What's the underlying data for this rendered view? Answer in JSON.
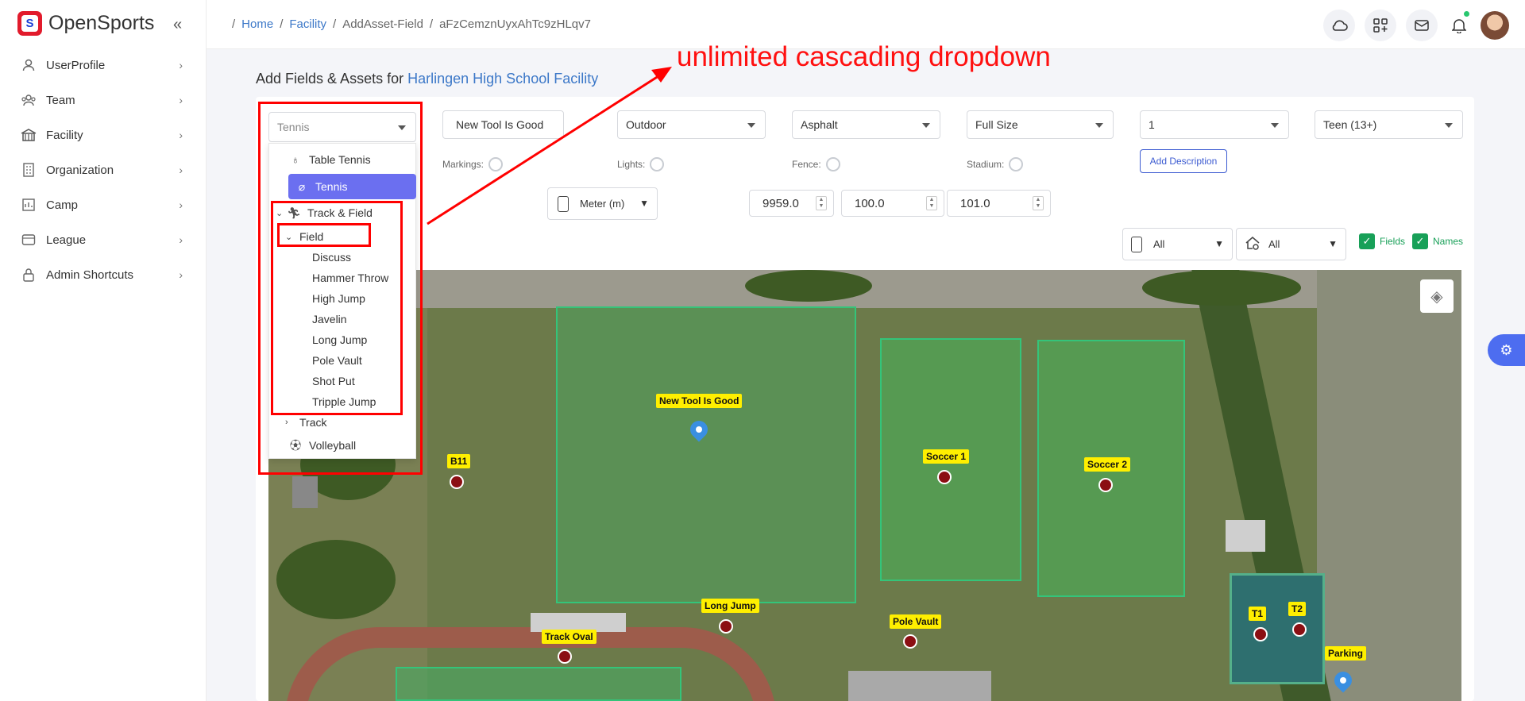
{
  "brand": {
    "name": "OpenSports",
    "logo_letter": "S",
    "collapse_icon": "«"
  },
  "sidebar": {
    "items": [
      {
        "label": "UserProfile",
        "icon": "user-icon"
      },
      {
        "label": "Team",
        "icon": "team-icon"
      },
      {
        "label": "Facility",
        "icon": "facility-icon"
      },
      {
        "label": "Organization",
        "icon": "building-icon"
      },
      {
        "label": "Camp",
        "icon": "camp-icon"
      },
      {
        "label": "League",
        "icon": "league-icon"
      },
      {
        "label": "Admin Shortcuts",
        "icon": "lock-icon"
      }
    ]
  },
  "breadcrumb": {
    "items": [
      {
        "label": "Home",
        "link": true
      },
      {
        "label": "Facility",
        "link": true
      },
      {
        "label": "AddAsset-Field",
        "link": false
      },
      {
        "label": "aFzCemznUyxAhTc9zHLqv7",
        "link": false
      }
    ]
  },
  "page": {
    "title_prefix": "Add Fields & Assets for",
    "facility_name": "Harlingen High School Facility"
  },
  "form": {
    "sport_select": "Tennis",
    "asset_name": "New Tool Is Good",
    "environment": "Outdoor",
    "surface": "Asphalt",
    "size": "Full Size",
    "count": "1",
    "age_group": "Teen (13+)",
    "markings_label": "Markings:",
    "lights_label": "Lights:",
    "fence_label": "Fence:",
    "stadium_label": "Stadium:",
    "add_description_label": "Add Description",
    "unit": "Meter (m)",
    "dim1": "9959.0",
    "dim2": "100.0",
    "dim3": "101.0",
    "filter1": "All",
    "filter2": "All",
    "fields_check_label": "Fields",
    "names_check_label": "Names"
  },
  "dropdown": {
    "items": [
      {
        "label": "Table Tennis",
        "level": 0,
        "icon": "table-tennis-icon"
      },
      {
        "label": "Tennis",
        "level": 0,
        "icon": "tennis-icon",
        "selected": true
      },
      {
        "label": "Track & Field",
        "level": 0,
        "icon": "runner-icon",
        "expanded": true
      },
      {
        "label": "Field",
        "level": 1,
        "expanded": true
      },
      {
        "label": "Discuss",
        "level": 2
      },
      {
        "label": "Hammer Throw",
        "level": 2
      },
      {
        "label": "High Jump",
        "level": 2
      },
      {
        "label": "Javelin",
        "level": 2
      },
      {
        "label": "Long Jump",
        "level": 2
      },
      {
        "label": "Pole Vault",
        "level": 2
      },
      {
        "label": "Shot Put",
        "level": 2
      },
      {
        "label": "Tripple Jump",
        "level": 2
      },
      {
        "label": "Track",
        "level": 1,
        "expanded": false
      },
      {
        "label": "Volleyball",
        "level": 0,
        "icon": "volleyball-icon"
      }
    ]
  },
  "map": {
    "markers": [
      {
        "label": "New Tool Is Good",
        "kind": "pin"
      },
      {
        "label": "B11",
        "kind": "dot"
      },
      {
        "label": "Soccer 1",
        "kind": "dot"
      },
      {
        "label": "Soccer 2",
        "kind": "dot"
      },
      {
        "label": "Long Jump",
        "kind": "dot"
      },
      {
        "label": "Pole Vault",
        "kind": "dot"
      },
      {
        "label": "Track Oval",
        "kind": "dot"
      },
      {
        "label": "T1",
        "kind": "dot"
      },
      {
        "label": "T2",
        "kind": "dot"
      },
      {
        "label": "Parking",
        "kind": "pin"
      }
    ]
  },
  "annotation": {
    "text": "unlimited cascading dropdown",
    "color": "#ff0000"
  },
  "colors": {
    "accent": "#3c78c8",
    "selected": "#6b6ff0",
    "check": "#18a058",
    "brand_red": "#e21b2c"
  }
}
